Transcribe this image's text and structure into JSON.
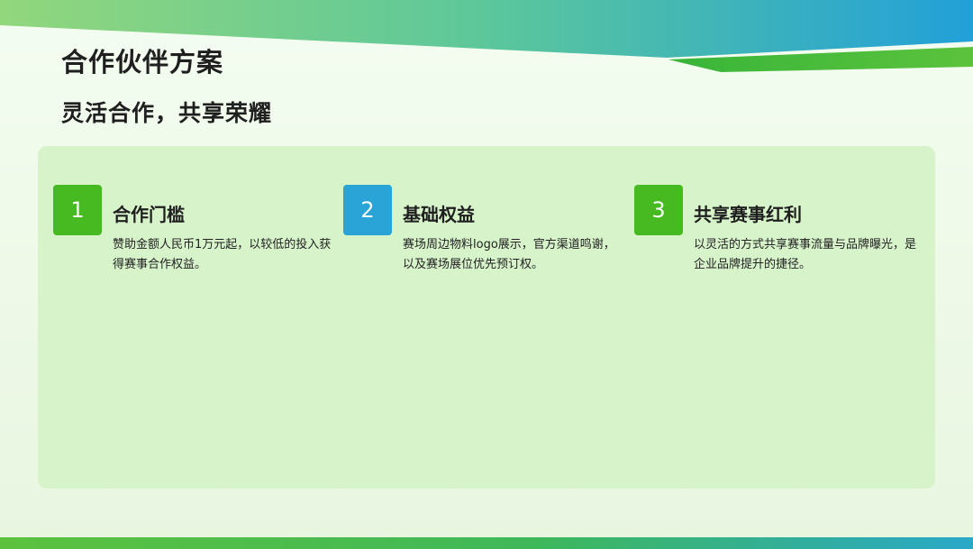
{
  "header": {
    "title": "合作伙伴方案",
    "subtitle": "灵活合作，共享荣耀"
  },
  "cards": [
    {
      "number": "1",
      "title": "合作门槛",
      "description": "赞助金额人民币1万元起，以较低的投入获得赛事合作权益。",
      "color": "#46ba20"
    },
    {
      "number": "2",
      "title": "基础权益",
      "description": "赛场周边物料logo展示，官方渠道鸣谢，以及赛场展位优先预订权。",
      "color": "#2aa3d6"
    },
    {
      "number": "3",
      "title": "共享赛事红利",
      "description": "以灵活的方式共享赛事流量与品牌曝光，是企业品牌提升的捷径。",
      "color": "#46ba20"
    }
  ],
  "theme": {
    "accent_green": "#46ba20",
    "accent_blue": "#2aa3d6",
    "panel_bg": "#d7f3ca"
  }
}
